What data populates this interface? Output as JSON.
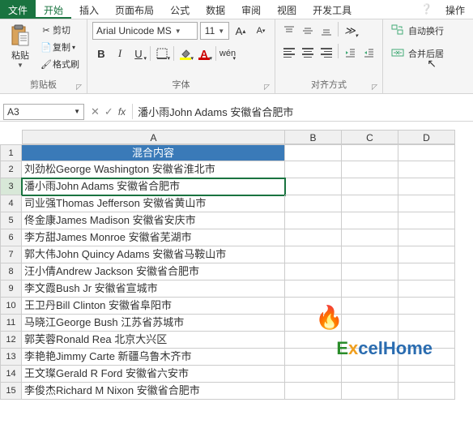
{
  "tabs": {
    "file": "文件",
    "home": "开始",
    "insert": "插入",
    "layout": "页面布局",
    "formula": "公式",
    "data": "数据",
    "review": "审阅",
    "view": "视图",
    "dev": "开发工具",
    "action": "操作"
  },
  "ribbon": {
    "clipboard": {
      "paste": "粘贴",
      "cut": "剪切",
      "copy": "复制",
      "format_painter": "格式刷",
      "title": "剪贴板"
    },
    "font": {
      "name": "Arial Unicode MS",
      "size": "11",
      "title": "字体",
      "bold": "B",
      "italic": "I",
      "underline": "U",
      "pinyin": "wén"
    },
    "align": {
      "title": "对齐方式",
      "wrap": "自动换行",
      "merge": "合并后居"
    }
  },
  "namebox": "A3",
  "formula": "潘小雨John Adams 安徽省合肥市",
  "columns": [
    "A",
    "B",
    "C",
    "D"
  ],
  "header_cell": "混合内容",
  "rows": [
    "刘劲松George Washington 安徽省淮北市",
    "潘小雨John Adams 安徽省合肥市",
    "司业强Thomas Jefferson 安徽省黄山市",
    "佟金康James Madison 安徽省安庆市",
    "李方甜James Monroe 安徽省芜湖市",
    "郭大伟John Quincy Adams 安徽省马鞍山市",
    "汪小倩Andrew Jackson 安徽省合肥市",
    "李文霞Bush Jr 安徽省宣城市",
    "王卫丹Bill Clinton 安徽省阜阳市",
    "马晓江George Bush 江苏省苏城市",
    "郭芙蓉Ronald Rea 北京大兴区",
    "李艳艳Jimmy Carte 新疆乌鲁木齐市",
    "王文璨Gerald R Ford 安徽省六安市",
    "李俊杰Richard M Nixon 安徽省合肥市"
  ],
  "active_row": 3,
  "watermark": {
    "e": "E",
    "x": "x",
    "rest": "celHome"
  }
}
